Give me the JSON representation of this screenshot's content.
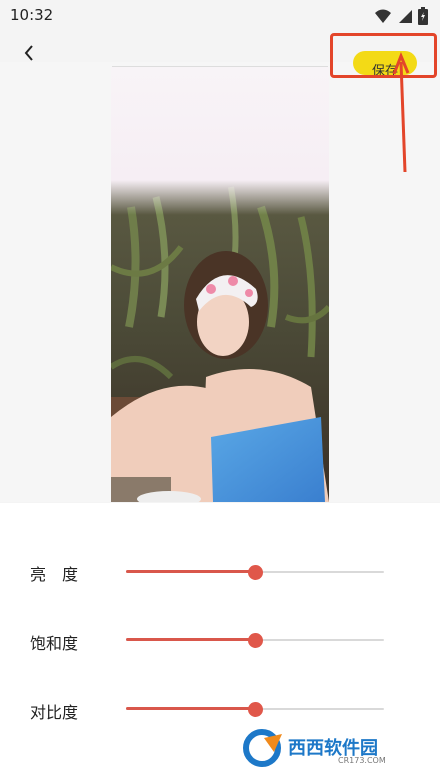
{
  "status_bar": {
    "time": "10:32"
  },
  "header": {
    "save_label": "保存"
  },
  "adjustments": [
    {
      "label": "亮　度",
      "value": 50
    },
    {
      "label": "饱和度",
      "value": 50
    },
    {
      "label": "对比度",
      "value": 50
    }
  ],
  "watermark": {
    "text": "西西软件园",
    "sub": "CR173.COM"
  },
  "colors": {
    "accent": "#e0574a",
    "save_button": "#f3da16",
    "highlight": "#e3452a"
  }
}
